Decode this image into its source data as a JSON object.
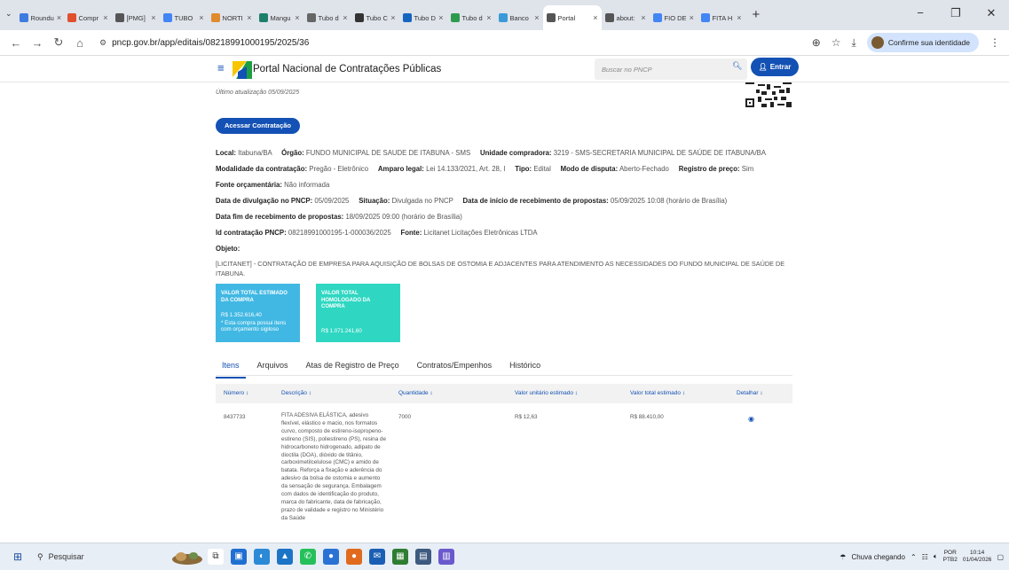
{
  "browser": {
    "tabs": [
      {
        "label": "Roundu",
        "color": "#3c7be0"
      },
      {
        "label": "Compr",
        "color": "#e0502e"
      },
      {
        "label": "[PMG]",
        "color": "#555555"
      },
      {
        "label": "TUBO",
        "color": "#4285f4"
      },
      {
        "label": "NORTI",
        "color": "#e08a2e"
      },
      {
        "label": "Mangu",
        "color": "#1d7f6a"
      },
      {
        "label": "Tubo d",
        "color": "#666666"
      },
      {
        "label": "Tubo C",
        "color": "#333333"
      },
      {
        "label": "Tubo D",
        "color": "#1565c0"
      },
      {
        "label": "Tubo d",
        "color": "#2e9a4e"
      },
      {
        "label": "Banco",
        "color": "#3a9ad9"
      },
      {
        "label": "Portal",
        "color": "#555555",
        "active": true
      },
      {
        "label": "about:",
        "color": "#555555"
      },
      {
        "label": "FIO DE",
        "color": "#4285f4"
      },
      {
        "label": "FITA H",
        "color": "#4285f4"
      }
    ],
    "url": "pncp.gov.br/app/editais/08218991000195/2025/36",
    "identity_label": "Confirme sua identidade"
  },
  "site": {
    "title": "Portal Nacional de Contratações Públicas",
    "search_placeholder": "Buscar no PNCP",
    "login_label": "Entrar"
  },
  "edital": {
    "last_update": "Último atualização 05/09/2025",
    "access_button": "Acessar Contratação",
    "local_label": "Local:",
    "local": "Itabuna/BA",
    "orgao_label": "Órgão:",
    "orgao": "FUNDO MUNICIPAL DE SAUDE DE ITABUNA - SMS",
    "unidade_label": "Unidade compradora:",
    "unidade": "3219 - SMS-SECRETARIA MUNICIPAL DE SAÚDE DE ITABUNA/BA",
    "modalidade_label": "Modalidade da contratação:",
    "modalidade": "Pregão - Eletrônico",
    "amparo_label": "Amparo legal:",
    "amparo": "Lei 14.133/2021, Art. 28, I",
    "tipo_label": "Tipo:",
    "tipo": "Edital",
    "disputa_label": "Modo de disputa:",
    "disputa": "Aberto-Fechado",
    "registro_label": "Registro de preço:",
    "registro": "Sim",
    "fonte_orc_label": "Fonte orçamentária:",
    "fonte_orc": "Não informada",
    "divulgacao_label": "Data de divulgação no PNCP:",
    "divulgacao": "05/09/2025",
    "situacao_label": "Situação:",
    "situacao": "Divulgada no PNCP",
    "inicio_label": "Data de início de recebimento de propostas:",
    "inicio": "05/09/2025 10:08 (horário de Brasília)",
    "fim_label": "Data fim de recebimento de propostas:",
    "fim": "18/09/2025 09:00 (horário de Brasília)",
    "id_label": "Id contratação PNCP:",
    "id": "08218991000195-1-000036/2025",
    "fonte_label": "Fonte:",
    "fonte": "Licitanet Licitações Eletrônicas LTDA",
    "objeto_label": "Objeto:",
    "objeto_line1": "[LICITANET] - CONTRATAÇÃO DE EMPRESA PARA AQUISIÇÃO DE BOLSAS DE OSTOMIA E ADJACENTES PARA ATENDIMENTO AS NECESSIDADES DO FUNDO MUNICIPAL DE SAÚDE DE",
    "objeto_line2": "ITABUNA."
  },
  "cards": {
    "estimado_title": "VALOR TOTAL ESTIMADO DA COMPRA",
    "estimado_value": "R$ 1.352.616,40",
    "estimado_note": "* Esta compra possui itens com orçamento sigiloso",
    "homologado_title": "VALOR TOTAL HOMOLOGADO DA COMPRA",
    "homologado_value": "R$ 1.071.241,60"
  },
  "tabs": [
    "Itens",
    "Arquivos",
    "Atas de Registro de Preço",
    "Contratos/Empenhos",
    "Histórico"
  ],
  "table": {
    "headers": [
      "Número ↕",
      "Descrição ↕",
      "Quantidade ↕",
      "Valor unitário estimado ↕",
      "Valor total estimado ↕",
      "Detalhar ↕"
    ],
    "row": {
      "numero": "8437733",
      "descricao": "FITA ADESIVA ELÁSTICA, adesivo flexível, elástico e macio, nos formatos curvo, composto de estireno-isopropeno-estireno (SIS), poliestireno (PS), resina de hidrocarboneto hidrogenado, adipato de dioctila (DOA), dióxido de titânio, carboximetilcelulose (CMC) e amido de batata. Reforça a fixação e aderência do adesivo da bolsa de ostomia e aumento da sensação de segurança. Embalagem com dados de identificação do produto, marca do fabricante, data de fabricação, prazo de validade e registro no Ministério da Saúde",
      "quantidade": "7000",
      "valor_unitario": "R$ 12,63",
      "valor_total": "R$ 88.410,00"
    }
  },
  "taskbar": {
    "search_label": "Pesquisar",
    "weather": "Chuva chegando",
    "lang1": "POR",
    "lang2": "PTB2",
    "time": "10:14",
    "date": "01/04/2026"
  }
}
